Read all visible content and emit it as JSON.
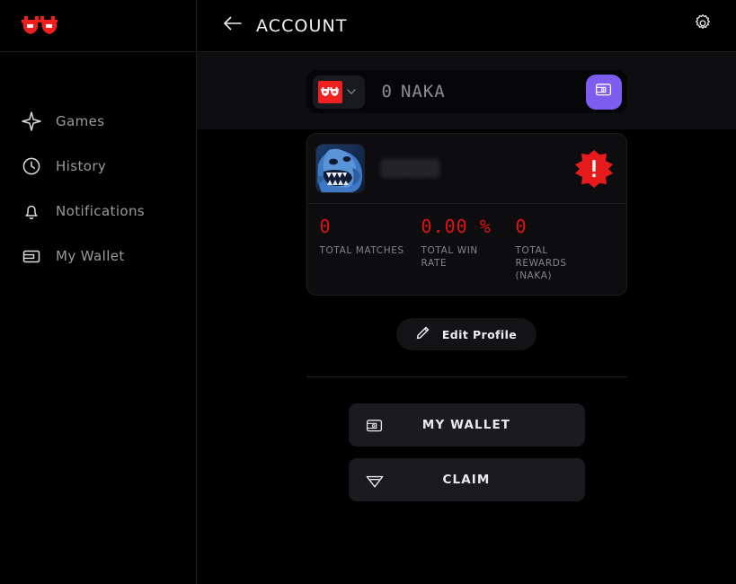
{
  "sidebar": {
    "logo_name": "naka-mask-logo",
    "items": [
      {
        "label": "Games",
        "icon": "sparkle-icon",
        "name": "sidebar-item-games"
      },
      {
        "label": "History",
        "icon": "clock-icon",
        "name": "sidebar-item-history"
      },
      {
        "label": "Notifications",
        "icon": "bell-icon",
        "name": "sidebar-item-notifications"
      },
      {
        "label": "My Wallet",
        "icon": "wallet-icon",
        "name": "sidebar-item-my-wallet"
      }
    ]
  },
  "header": {
    "back_icon": "arrow-left-icon",
    "title": "ACCOUNT",
    "settings_icon": "gear-icon"
  },
  "balance_bar": {
    "chain_logo_icon": "naka-mask-icon",
    "chain_chevron_icon": "chevron-down-icon",
    "amount": "0",
    "token": "NAKA",
    "wallet_button_icon": "wallet-icon"
  },
  "profile": {
    "avatar_icon": "monster-avatar",
    "username": "",
    "username_redacted": true,
    "alert_badge_icon": "alert-burst-icon",
    "alert_badge_color": "#e51b1b",
    "stats": [
      {
        "value": "0",
        "label": "TOTAL MATCHES"
      },
      {
        "value": "0.00 %",
        "label": "TOTAL WIN RATE"
      },
      {
        "value": "0",
        "label": "TOTAL REWARDS (NAKA)"
      }
    ],
    "edit_button": {
      "label": "Edit Profile",
      "icon": "pencil-icon"
    }
  },
  "actions": [
    {
      "label": "MY WALLET",
      "icon": "wallet-icon",
      "name": "my-wallet-button"
    },
    {
      "label": "CLAIM",
      "icon": "diamond-icon",
      "name": "claim-button"
    }
  ],
  "colors": {
    "accent_red": "#e01212",
    "accent_purple": "#7d5cf0",
    "background": "#000000",
    "card": "#0d0d10",
    "text_muted": "#8d8d92"
  }
}
